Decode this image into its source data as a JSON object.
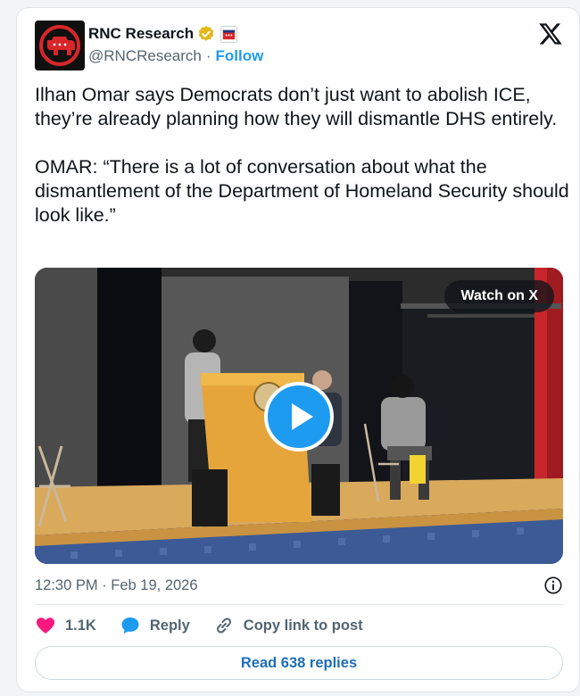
{
  "author": {
    "name": "RNC Research",
    "handle": "@RNCResearch",
    "separator": "·",
    "follow_label": "Follow",
    "verified_icon": "verified-badge-icon",
    "affiliation_icon": "affiliation-badge-icon"
  },
  "tweet": {
    "text": "Ilhan Omar says Democrats don’t just want to abolish ICE, they’re already planning how they will dismantle DHS entirely.\n\nOMAR: “There is a lot of conversation about what the dismantlement of the Department of Homeland Security should look like.”"
  },
  "media": {
    "watch_label": "Watch on X",
    "play_icon": "play-icon"
  },
  "meta": {
    "timestamp": "12:30 PM · Feb 19, 2026",
    "info_icon": "info-icon"
  },
  "actions": {
    "likes_count": "1.1K",
    "reply_label": "Reply",
    "copy_link_label": "Copy link to post"
  },
  "footer": {
    "read_replies_label": "Read 638 replies"
  },
  "colors": {
    "accent": "#1d9bf0",
    "heart": "#f91880",
    "verified": "#e2b719",
    "text": "#0f1419",
    "muted": "#536471"
  }
}
